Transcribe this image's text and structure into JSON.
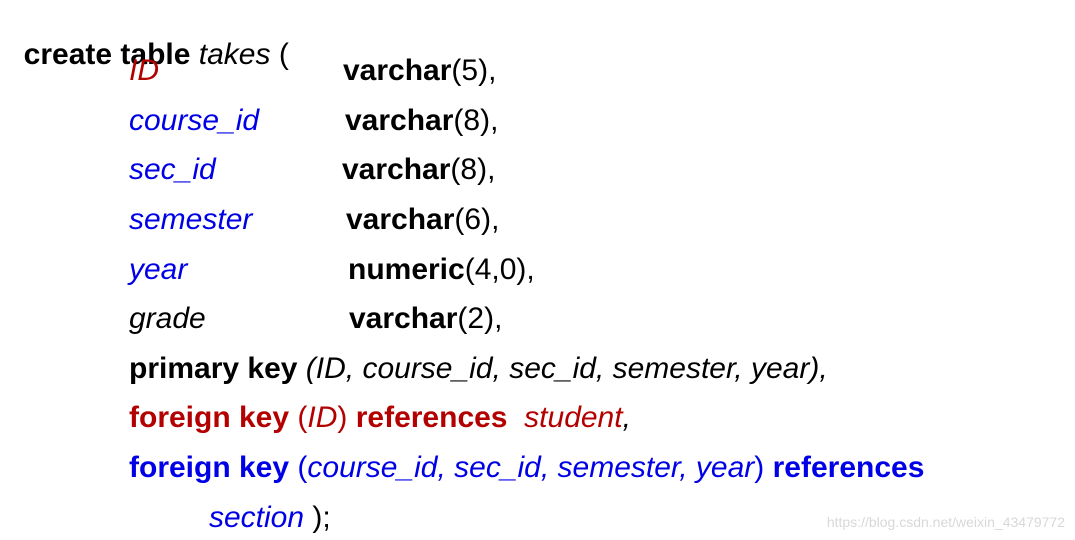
{
  "header": {
    "kw": "create table",
    "table_name": "takes",
    "open": " ("
  },
  "columns": [
    {
      "name": "ID",
      "type": "varchar",
      "args": "(5),"
    },
    {
      "name": "course_id",
      "type": "varchar",
      "args": "(8),"
    },
    {
      "name": "sec_id",
      "type": "varchar",
      "args": "(8),"
    },
    {
      "name": "semester",
      "type": "varchar",
      "args": "(6),"
    },
    {
      "name": "year",
      "type": "numeric",
      "args": "(4,0),"
    },
    {
      "name": "grade",
      "type": "varchar",
      "args": "(2),"
    }
  ],
  "primary_key": {
    "kw": "primary key",
    "cols": " (ID, course_id, sec_id, semester, year),"
  },
  "fk1": {
    "kw": "foreign key",
    "open": " (",
    "col": "ID",
    "close": ") ",
    "ref_kw": "references",
    "gap": "  ",
    "table": "student",
    "comma": ","
  },
  "fk2": {
    "kw": "foreign key",
    "open": " (",
    "cols": "course_id, sec_id, semester, year",
    "close": ") ",
    "ref_kw": "references",
    "table": "section",
    "end": " );"
  },
  "watermark": "https://blog.csdn.net/weixin_43479772",
  "colors": {
    "red": "#b30000",
    "blue": "#0000e6",
    "black": "#000000"
  }
}
